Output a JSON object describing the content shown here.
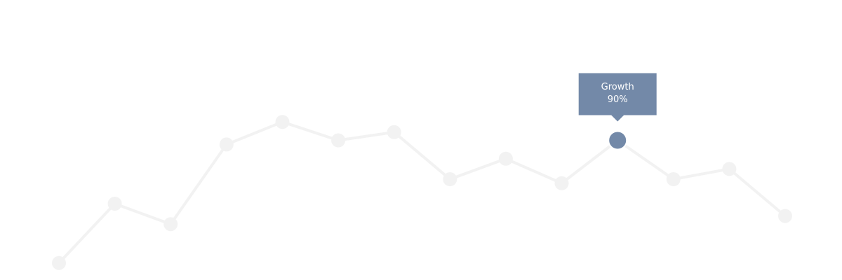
{
  "chart_data": {
    "type": "line",
    "x": [
      1,
      2,
      3,
      4,
      5,
      6,
      7,
      8,
      9,
      10,
      11,
      12,
      13,
      14
    ],
    "series": [
      {
        "values": [
          9,
          38,
          28,
          67,
          78,
          69,
          73,
          50,
          60,
          48,
          69,
          50,
          55,
          32
        ]
      }
    ],
    "xlim": [
      1,
      14
    ],
    "ylim": [
      0,
      100
    ],
    "grid": false,
    "highlight": {
      "index": 10,
      "label": "Growth",
      "value_text": "90%"
    },
    "colors": {
      "line": "#f2f2f2",
      "point": "#f2f2f2",
      "highlight": "#7389a8",
      "tooltip_bg": "#7389a8",
      "tooltip_text": "#ffffff"
    }
  }
}
